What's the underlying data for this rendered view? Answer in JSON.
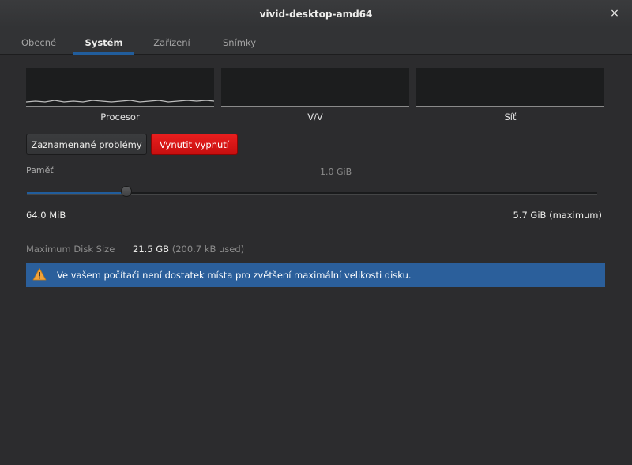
{
  "window": {
    "title": "vivid-desktop-amd64",
    "close_glyph": "×"
  },
  "tabs": [
    {
      "label": "Obecné"
    },
    {
      "label": "Systém"
    },
    {
      "label": "Zařízení"
    },
    {
      "label": "Snímky"
    }
  ],
  "active_tab": "Systém",
  "graphs": {
    "cpu_label": "Procesor",
    "io_label": "V/V",
    "net_label": "Síť"
  },
  "buttons": {
    "problems": "Zaznamenané problémy",
    "force_off": "Vynutit vypnutí"
  },
  "memory": {
    "label": "Paměť",
    "current": "1.0 GiB",
    "min": "64.0 MiB",
    "max": "5.7 GiB (maximum)",
    "slider_fraction": 0.175
  },
  "disk": {
    "label": "Maximum Disk Size",
    "size": "21.5 GB",
    "used": "(200.7 kB used)"
  },
  "infobar": {
    "message": "Ve vašem počítači není dostatek místa pro zvětšení maximální velikosti disku.",
    "icon": "warning-icon"
  },
  "colors": {
    "accent": "#215d9c",
    "danger": "#d41616",
    "info_bg": "#2b5f9b"
  }
}
